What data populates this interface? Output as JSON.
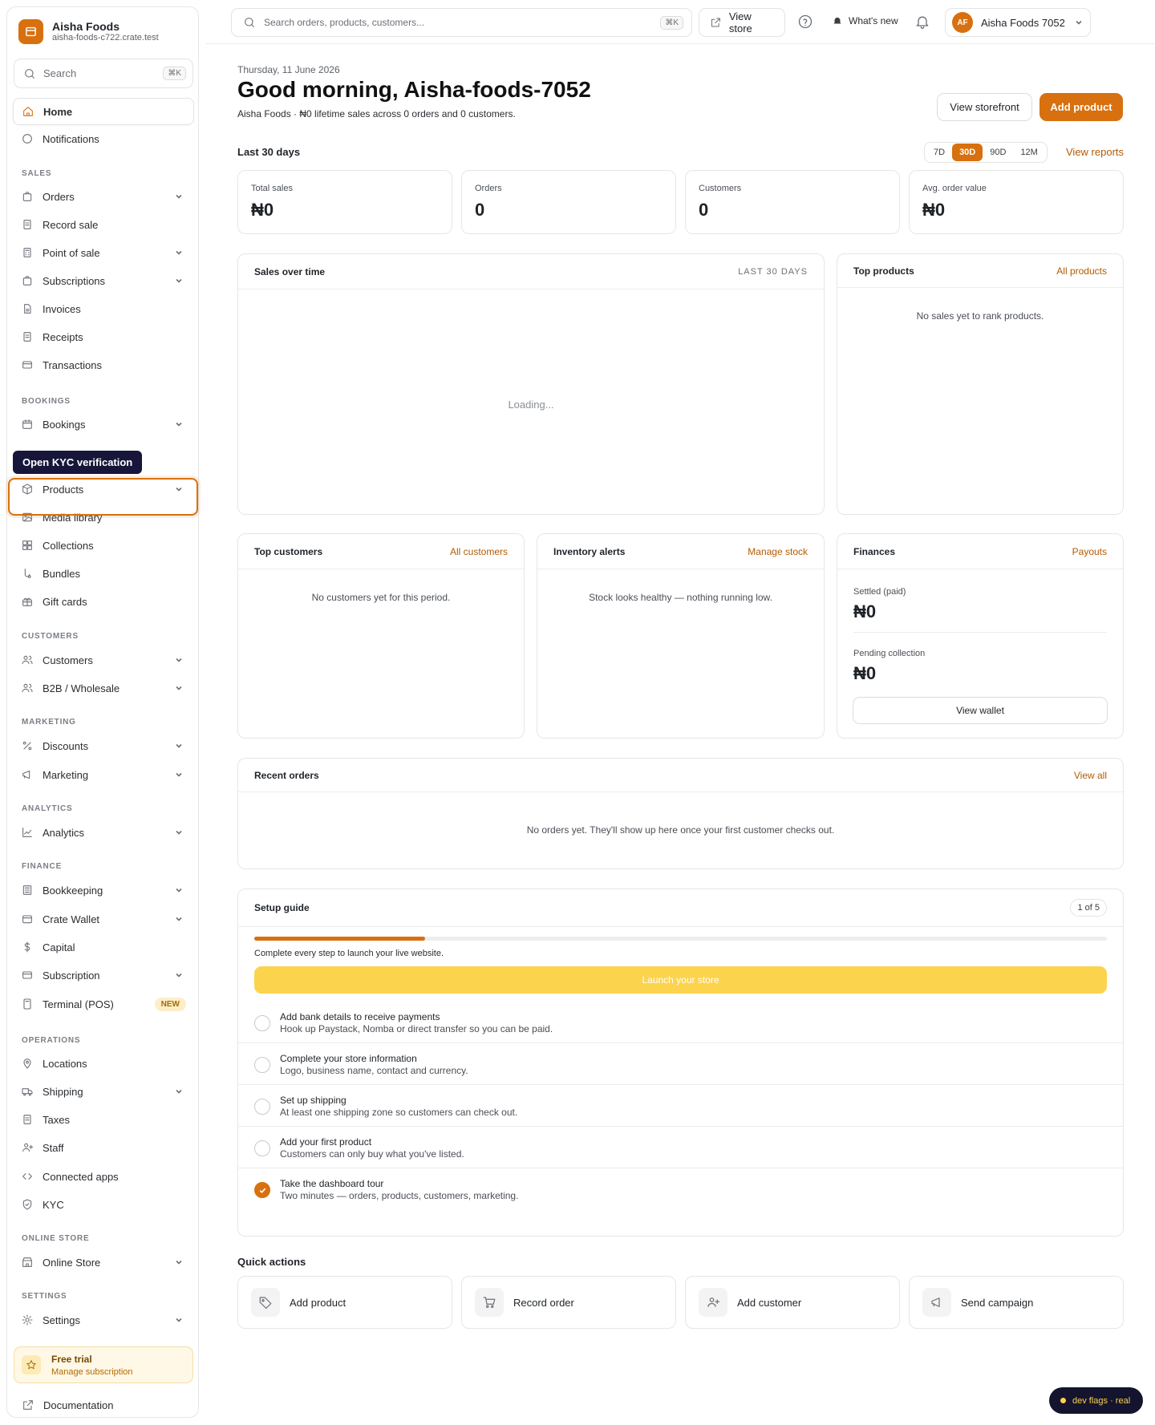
{
  "brand": {
    "name": "Aisha Foods",
    "domain": "aisha-foods-c722.crate.test"
  },
  "sidebar": {
    "search_placeholder": "Search",
    "search_kbd": "⌘K",
    "home": "Home",
    "notifications": "Notifications",
    "sections": {
      "sales": "SALES",
      "bookings": "BOOKINGS",
      "customers": "CUSTOMERS",
      "marketing": "MARKETING",
      "analytics": "ANALYTICS",
      "finance": "FINANCE",
      "operations": "OPERATIONS",
      "online_store": "ONLINE STORE",
      "settings": "SETTINGS"
    },
    "items": {
      "orders": "Orders",
      "record_sale": "Record sale",
      "pos": "Point of sale",
      "subscriptions": "Subscriptions",
      "invoices": "Invoices",
      "receipts": "Receipts",
      "transactions": "Transactions",
      "bookings": "Bookings",
      "products": "Products",
      "media": "Media library",
      "collections": "Collections",
      "bundles": "Bundles",
      "gift_cards": "Gift cards",
      "customers": "Customers",
      "b2b": "B2B / Wholesale",
      "discounts": "Discounts",
      "marketing": "Marketing",
      "analytics": "Analytics",
      "bookkeeping": "Bookkeeping",
      "wallet": "Crate Wallet",
      "capital": "Capital",
      "subscription": "Subscription",
      "terminal": "Terminal (POS)",
      "locations": "Locations",
      "shipping": "Shipping",
      "taxes": "Taxes",
      "staff": "Staff",
      "connected_apps": "Connected apps",
      "kyc": "KYC",
      "online_store": "Online Store",
      "settings": "Settings"
    },
    "new_badge": "NEW",
    "tooltip": "Open KYC verification",
    "trial": {
      "title": "Free trial",
      "link": "Manage subscription"
    },
    "docs": "Documentation"
  },
  "topbar": {
    "search_placeholder": "Search orders, products, customers...",
    "search_kbd": "⌘K",
    "view_store": "View store",
    "whats_new": "What's new",
    "avatar": "AF",
    "account": "Aisha Foods 7052"
  },
  "header": {
    "date": "Thursday, 11 June 2026",
    "greeting": "Good morning, Aisha-foods-7052",
    "store": "Aisha Foods",
    "summary": " · ₦0 lifetime sales across 0 orders and 0 customers.",
    "view_storefront": "View storefront",
    "add_product": "Add product"
  },
  "period": {
    "label": "Last 30 days",
    "ranges": [
      "7D",
      "30D",
      "90D",
      "12M"
    ],
    "active": "30D",
    "view_reports": "View reports"
  },
  "kpis": [
    {
      "label": "Total sales",
      "value": "₦0"
    },
    {
      "label": "Orders",
      "value": "0"
    },
    {
      "label": "Customers",
      "value": "0"
    },
    {
      "label": "Avg. order value",
      "value": "₦0"
    }
  ],
  "sales_chart": {
    "title": "Sales over time",
    "range": "LAST 30 DAYS",
    "loading": "Loading..."
  },
  "top_products": {
    "title": "Top products",
    "link": "All products",
    "empty": "No sales yet to rank products."
  },
  "top_customers": {
    "title": "Top customers",
    "link": "All customers",
    "empty": "No customers yet for this period."
  },
  "inventory": {
    "title": "Inventory alerts",
    "link": "Manage stock",
    "empty": "Stock looks healthy — nothing running low."
  },
  "finances": {
    "title": "Finances",
    "link": "Payouts",
    "settled_label": "Settled (paid)",
    "settled": "₦0",
    "pending_label": "Pending collection",
    "pending": "₦0",
    "wallet": "View wallet"
  },
  "recent_orders": {
    "title": "Recent orders",
    "link": "View all",
    "empty": "No orders yet. They'll show up here once your first customer checks out."
  },
  "setup": {
    "title": "Setup guide",
    "count": "1 of 5",
    "progress": 0.2,
    "hint": "Complete every step to launch your live website.",
    "launch": "Launch your store",
    "steps": [
      {
        "title": "Add bank details to receive payments",
        "desc": "Hook up Paystack, Nomba or direct transfer so you can be paid.",
        "done": false
      },
      {
        "title": "Complete your store information",
        "desc": "Logo, business name, contact and currency.",
        "done": false
      },
      {
        "title": "Set up shipping",
        "desc": "At least one shipping zone so customers can check out.",
        "done": false
      },
      {
        "title": "Add your first product",
        "desc": "Customers can only buy what you've listed.",
        "done": false
      },
      {
        "title": "Take the dashboard tour",
        "desc": "Two minutes — orders, products, customers, marketing.",
        "done": true
      }
    ]
  },
  "quick_actions": {
    "title": "Quick actions",
    "items": [
      "Add product",
      "Record order",
      "Add customer",
      "Send campaign"
    ]
  },
  "dev_flags": "dev flags · real"
}
